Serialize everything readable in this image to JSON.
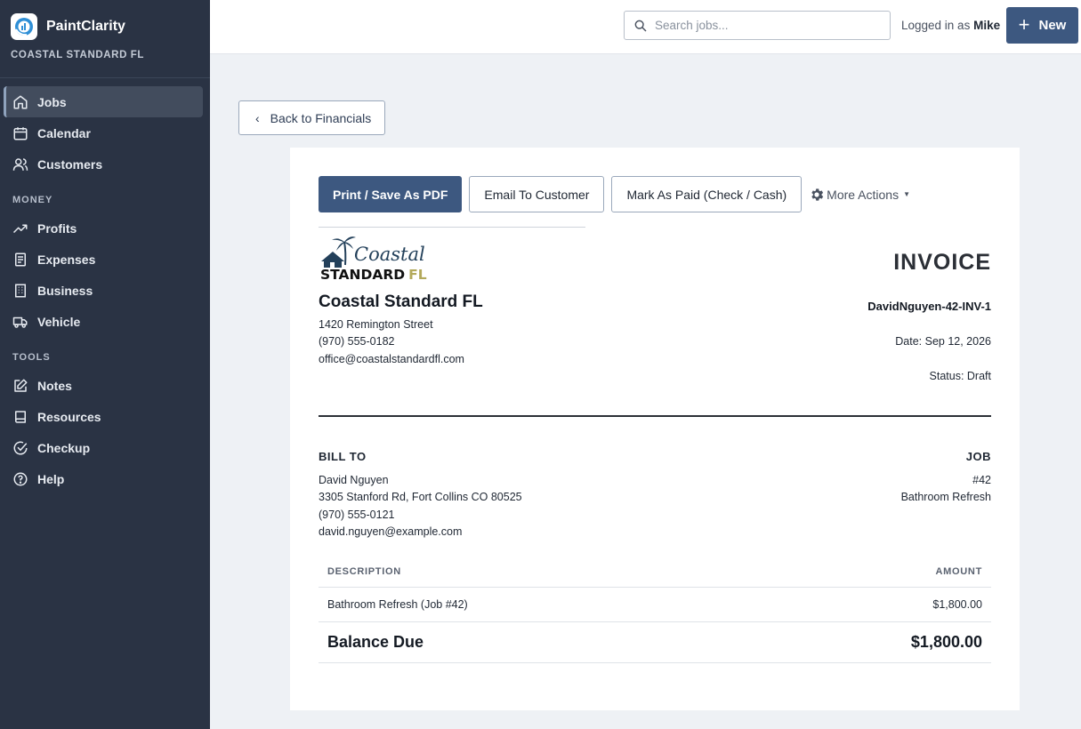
{
  "app": {
    "name": "PaintClarity",
    "org": "COASTAL STANDARD FL"
  },
  "sidebar": {
    "items": [
      {
        "label": "Jobs",
        "icon": "home-icon"
      },
      {
        "label": "Calendar",
        "icon": "calendar-icon"
      },
      {
        "label": "Customers",
        "icon": "users-icon"
      }
    ],
    "money_title": "MONEY",
    "money": [
      {
        "label": "Profits",
        "icon": "trending-up-icon"
      },
      {
        "label": "Expenses",
        "icon": "receipt-icon"
      },
      {
        "label": "Business",
        "icon": "building-icon"
      },
      {
        "label": "Vehicle",
        "icon": "truck-icon"
      }
    ],
    "tools_title": "TOOLS",
    "tools": [
      {
        "label": "Notes",
        "icon": "edit-icon"
      },
      {
        "label": "Resources",
        "icon": "book-icon"
      },
      {
        "label": "Checkup",
        "icon": "check-circle-icon"
      },
      {
        "label": "Help",
        "icon": "help-circle-icon"
      }
    ]
  },
  "topbar": {
    "search_placeholder": "Search jobs...",
    "logged_in_prefix": "Logged in as",
    "user": "Mike",
    "new_label": "New"
  },
  "back_label": "Back to Financials",
  "actions": {
    "print": "Print / Save As PDF",
    "email": "Email To Customer",
    "mark_paid": "Mark As Paid (Check / Cash)",
    "more": "More Actions"
  },
  "logo": {
    "line1": "Coastal",
    "line2": "STANDARD",
    "line2_accent": "FL"
  },
  "business": {
    "name": "Coastal Standard FL",
    "address": "1420 Remington Street",
    "phone": "(970) 555-0182",
    "email": "office@coastalstandardfl.com"
  },
  "invoice": {
    "title": "INVOICE",
    "number": "DavidNguyen-42-INV-1",
    "date": "Date: Sep 12, 2026",
    "status": "Status: Draft"
  },
  "bill_to": {
    "title": "BILL TO",
    "name": "David Nguyen",
    "address": "3305 Stanford Rd, Fort Collins CO 80525",
    "phone": "(970) 555-0121",
    "email": "david.nguyen@example.com"
  },
  "job": {
    "title": "JOB",
    "number": "#42",
    "name": "Bathroom Refresh"
  },
  "table": {
    "col_description": "DESCRIPTION",
    "col_amount": "AMOUNT",
    "rows": [
      {
        "description": "Bathroom Refresh (Job #42)",
        "amount": "$1,800.00"
      }
    ],
    "total_label": "Balance Due",
    "total_amount": "$1,800.00"
  },
  "colors": {
    "sidebar": "#2a3344",
    "primary": "#3d5880",
    "background": "#eef1f5"
  }
}
